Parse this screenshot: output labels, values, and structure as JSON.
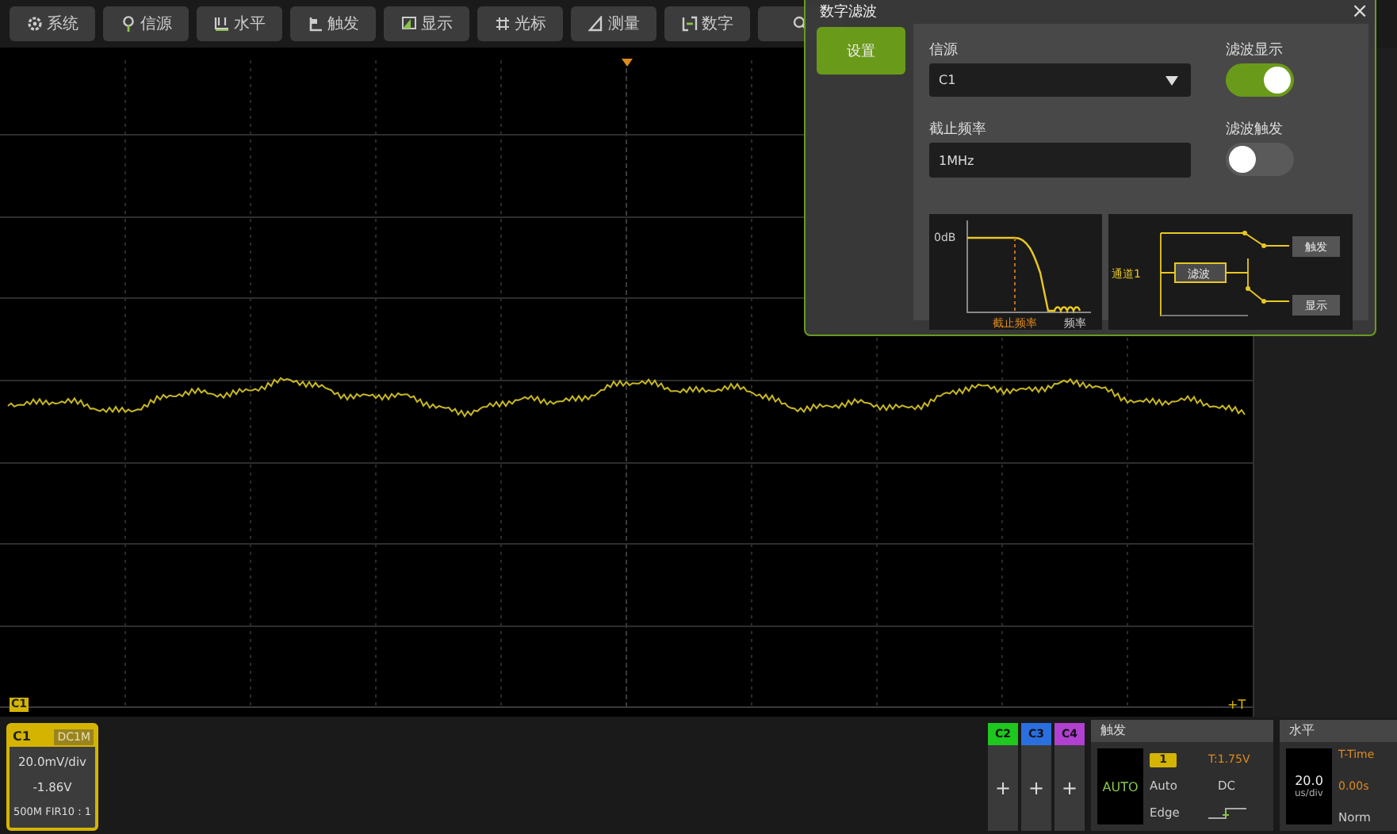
{
  "toolbar": [
    {
      "kind": "gear",
      "label": "系统"
    },
    {
      "kind": "probe",
      "label": "信源"
    },
    {
      "kind": "horizontal",
      "label": "水平"
    },
    {
      "kind": "trigger",
      "label": "触发"
    },
    {
      "kind": "display",
      "label": "显示"
    },
    {
      "kind": "cursor",
      "label": "光标"
    },
    {
      "kind": "measure",
      "label": "测量"
    },
    {
      "kind": "math",
      "label": "数字"
    },
    {
      "kind": "search"
    }
  ],
  "screen": {
    "channel_marker": "C1",
    "time_marker": "+T"
  },
  "dialog": {
    "title": "数字滤波",
    "close": "×",
    "tabs": [
      {
        "label": "设置",
        "selected": true
      }
    ],
    "source": {
      "label": "信源",
      "value": "C1"
    },
    "cutoff": {
      "label": "截止频率",
      "value": "1MHz"
    },
    "toggles": [
      {
        "label": "滤波显示",
        "on": true
      },
      {
        "label": "滤波触发",
        "on": false
      }
    ],
    "response_diagram": {
      "level_label": "0dB",
      "cutoff_label": "截止频率",
      "axis_label": "频率"
    },
    "routing_diagram": {
      "input": "通道1",
      "filter": "滤波",
      "outputs": [
        "触发",
        "显示"
      ]
    }
  },
  "channel_card": {
    "name": "C1",
    "coupling": "DC1M",
    "scale": "20.0mV/div",
    "offset": "-1.86V",
    "info": "500M FIR10 : 1"
  },
  "channel_buttons": [
    {
      "name": "C2",
      "color": "#1ec81e",
      "symbol": "+"
    },
    {
      "name": "C3",
      "color": "#2a6fe0",
      "symbol": "+"
    },
    {
      "name": "C4",
      "color": "#b040d0",
      "symbol": "+"
    }
  ],
  "trigger": {
    "title": "触发",
    "mode": "AUTO",
    "source": "1",
    "level": "T:1.75V",
    "sweep": "Auto",
    "coupling": "DC",
    "type": "Edge"
  },
  "horizontal": {
    "title": "水平",
    "scale": "20.0",
    "unit": "us/div",
    "reference": "T-Time",
    "position": "0.00s",
    "mode": "Norm"
  }
}
